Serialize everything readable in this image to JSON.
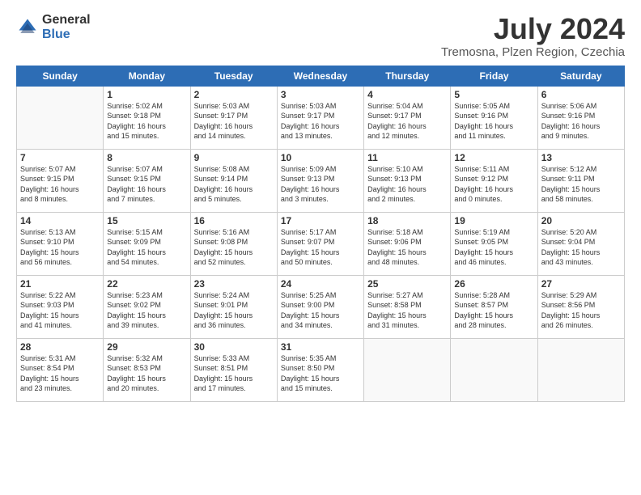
{
  "logo": {
    "line1": "General",
    "line2": "Blue"
  },
  "title": "July 2024",
  "subtitle": "Tremosna, Plzen Region, Czechia",
  "days_header": [
    "Sunday",
    "Monday",
    "Tuesday",
    "Wednesday",
    "Thursday",
    "Friday",
    "Saturday"
  ],
  "weeks": [
    [
      {
        "num": "",
        "info": ""
      },
      {
        "num": "1",
        "info": "Sunrise: 5:02 AM\nSunset: 9:18 PM\nDaylight: 16 hours\nand 15 minutes."
      },
      {
        "num": "2",
        "info": "Sunrise: 5:03 AM\nSunset: 9:17 PM\nDaylight: 16 hours\nand 14 minutes."
      },
      {
        "num": "3",
        "info": "Sunrise: 5:03 AM\nSunset: 9:17 PM\nDaylight: 16 hours\nand 13 minutes."
      },
      {
        "num": "4",
        "info": "Sunrise: 5:04 AM\nSunset: 9:17 PM\nDaylight: 16 hours\nand 12 minutes."
      },
      {
        "num": "5",
        "info": "Sunrise: 5:05 AM\nSunset: 9:16 PM\nDaylight: 16 hours\nand 11 minutes."
      },
      {
        "num": "6",
        "info": "Sunrise: 5:06 AM\nSunset: 9:16 PM\nDaylight: 16 hours\nand 9 minutes."
      }
    ],
    [
      {
        "num": "7",
        "info": "Sunrise: 5:07 AM\nSunset: 9:15 PM\nDaylight: 16 hours\nand 8 minutes."
      },
      {
        "num": "8",
        "info": "Sunrise: 5:07 AM\nSunset: 9:15 PM\nDaylight: 16 hours\nand 7 minutes."
      },
      {
        "num": "9",
        "info": "Sunrise: 5:08 AM\nSunset: 9:14 PM\nDaylight: 16 hours\nand 5 minutes."
      },
      {
        "num": "10",
        "info": "Sunrise: 5:09 AM\nSunset: 9:13 PM\nDaylight: 16 hours\nand 3 minutes."
      },
      {
        "num": "11",
        "info": "Sunrise: 5:10 AM\nSunset: 9:13 PM\nDaylight: 16 hours\nand 2 minutes."
      },
      {
        "num": "12",
        "info": "Sunrise: 5:11 AM\nSunset: 9:12 PM\nDaylight: 16 hours\nand 0 minutes."
      },
      {
        "num": "13",
        "info": "Sunrise: 5:12 AM\nSunset: 9:11 PM\nDaylight: 15 hours\nand 58 minutes."
      }
    ],
    [
      {
        "num": "14",
        "info": "Sunrise: 5:13 AM\nSunset: 9:10 PM\nDaylight: 15 hours\nand 56 minutes."
      },
      {
        "num": "15",
        "info": "Sunrise: 5:15 AM\nSunset: 9:09 PM\nDaylight: 15 hours\nand 54 minutes."
      },
      {
        "num": "16",
        "info": "Sunrise: 5:16 AM\nSunset: 9:08 PM\nDaylight: 15 hours\nand 52 minutes."
      },
      {
        "num": "17",
        "info": "Sunrise: 5:17 AM\nSunset: 9:07 PM\nDaylight: 15 hours\nand 50 minutes."
      },
      {
        "num": "18",
        "info": "Sunrise: 5:18 AM\nSunset: 9:06 PM\nDaylight: 15 hours\nand 48 minutes."
      },
      {
        "num": "19",
        "info": "Sunrise: 5:19 AM\nSunset: 9:05 PM\nDaylight: 15 hours\nand 46 minutes."
      },
      {
        "num": "20",
        "info": "Sunrise: 5:20 AM\nSunset: 9:04 PM\nDaylight: 15 hours\nand 43 minutes."
      }
    ],
    [
      {
        "num": "21",
        "info": "Sunrise: 5:22 AM\nSunset: 9:03 PM\nDaylight: 15 hours\nand 41 minutes."
      },
      {
        "num": "22",
        "info": "Sunrise: 5:23 AM\nSunset: 9:02 PM\nDaylight: 15 hours\nand 39 minutes."
      },
      {
        "num": "23",
        "info": "Sunrise: 5:24 AM\nSunset: 9:01 PM\nDaylight: 15 hours\nand 36 minutes."
      },
      {
        "num": "24",
        "info": "Sunrise: 5:25 AM\nSunset: 9:00 PM\nDaylight: 15 hours\nand 34 minutes."
      },
      {
        "num": "25",
        "info": "Sunrise: 5:27 AM\nSunset: 8:58 PM\nDaylight: 15 hours\nand 31 minutes."
      },
      {
        "num": "26",
        "info": "Sunrise: 5:28 AM\nSunset: 8:57 PM\nDaylight: 15 hours\nand 28 minutes."
      },
      {
        "num": "27",
        "info": "Sunrise: 5:29 AM\nSunset: 8:56 PM\nDaylight: 15 hours\nand 26 minutes."
      }
    ],
    [
      {
        "num": "28",
        "info": "Sunrise: 5:31 AM\nSunset: 8:54 PM\nDaylight: 15 hours\nand 23 minutes."
      },
      {
        "num": "29",
        "info": "Sunrise: 5:32 AM\nSunset: 8:53 PM\nDaylight: 15 hours\nand 20 minutes."
      },
      {
        "num": "30",
        "info": "Sunrise: 5:33 AM\nSunset: 8:51 PM\nDaylight: 15 hours\nand 17 minutes."
      },
      {
        "num": "31",
        "info": "Sunrise: 5:35 AM\nSunset: 8:50 PM\nDaylight: 15 hours\nand 15 minutes."
      },
      {
        "num": "",
        "info": ""
      },
      {
        "num": "",
        "info": ""
      },
      {
        "num": "",
        "info": ""
      }
    ]
  ]
}
